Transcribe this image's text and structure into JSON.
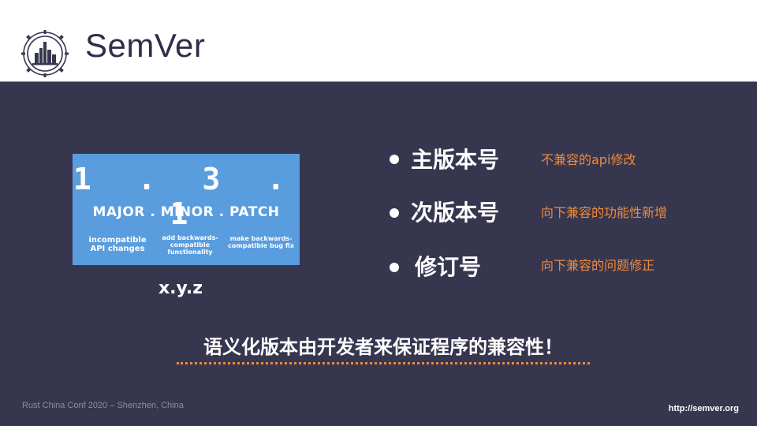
{
  "header": {
    "title": "SemVer",
    "logo_icon": "rust-china-conf-logo-icon"
  },
  "version_card": {
    "digits": "1 . 3 . 1",
    "labels": "MAJOR . MINOR . PATCH",
    "desc_major": "incompatible API changes",
    "desc_minor": "add backwards-compatible functionality",
    "desc_patch": "make backwards-compatible bug fix",
    "background_color": "#5a9ddf"
  },
  "version_format": "x.y.z",
  "items": [
    {
      "term": "主版本号",
      "note": "不兼容的api修改"
    },
    {
      "term": "次版本号",
      "note": "向下兼容的功能性新增"
    },
    {
      "term": "修订号",
      "note": "向下兼容的问题修正"
    }
  ],
  "tagline": "语义化版本由开发者来保证程序的兼容性！",
  "footer": {
    "left": "Rust China Conf 2020 – Shenzhen, China",
    "right": "http://semver.org"
  },
  "colors": {
    "background": "#37364f",
    "accent": "#ef8a3b",
    "header_bg": "#ffffff"
  }
}
